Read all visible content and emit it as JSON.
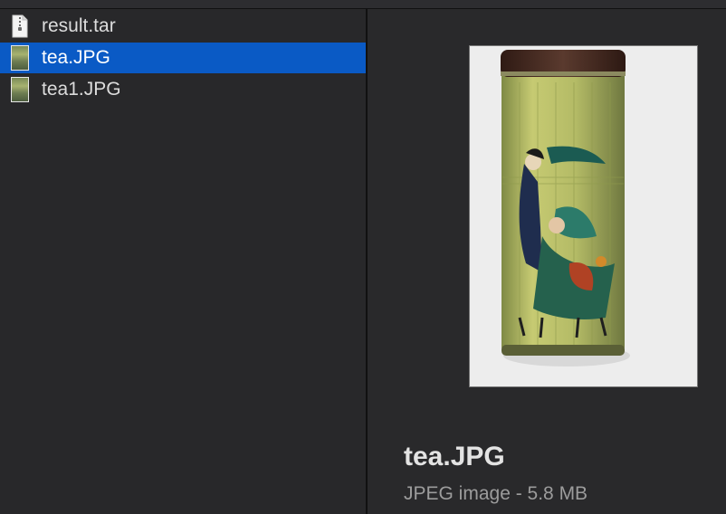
{
  "files": [
    {
      "name": "result.tar",
      "icon": "document-icon",
      "selected": false
    },
    {
      "name": "tea.JPG",
      "icon": "image-thumbnail-icon",
      "selected": true
    },
    {
      "name": "tea1.JPG",
      "icon": "image-thumbnail-icon",
      "selected": false
    }
  ],
  "preview": {
    "title": "tea.JPG",
    "subtitle": "JPEG image - 5.8 MB"
  },
  "colors": {
    "selection": "#0a5ac5",
    "background": "#2a2a2c",
    "text": "#dcdcdc",
    "subtext": "#9c9c9c"
  }
}
